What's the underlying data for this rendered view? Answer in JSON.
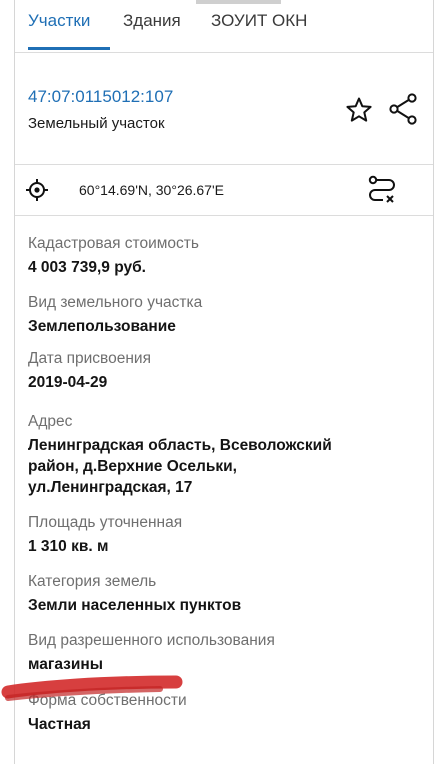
{
  "tabs": [
    {
      "label": "Участки",
      "active": true
    },
    {
      "label": "Здания",
      "active": false
    },
    {
      "label": "ЗОУИТ ОКН",
      "active": false
    }
  ],
  "header": {
    "cadastral_number": "47:07:0115012:107",
    "object_type": "Земельный участок"
  },
  "location": {
    "coordinates": "60°14.69'N, 30°26.67'E"
  },
  "fields": [
    {
      "label": "Кадастровая стоимость",
      "value": "4 003 739,9 руб."
    },
    {
      "label": "Вид земельного участка",
      "value": "Землепользование"
    },
    {
      "label": "Дата присвоения",
      "value": "2019-04-29"
    },
    {
      "label": "Адрес",
      "value_lines": [
        "Ленинградская область, Всеволожский",
        "район, д.Верхние Осельки,",
        "ул.Ленинградская, 17"
      ]
    },
    {
      "label": "Площадь уточненная",
      "value": "1 310 кв. м"
    },
    {
      "label": "Категория земель",
      "value": "Земли населенных пунктов"
    },
    {
      "label": "Вид разрешенного использования",
      "value": "магазины"
    },
    {
      "label": "Форма собственности",
      "value": "Частная"
    }
  ],
  "icons": [
    "star-icon",
    "share-icon",
    "target-icon",
    "route-icon"
  ],
  "colors": {
    "accent": "#1f6fb5",
    "highlight_mark": "#d32a2a"
  }
}
